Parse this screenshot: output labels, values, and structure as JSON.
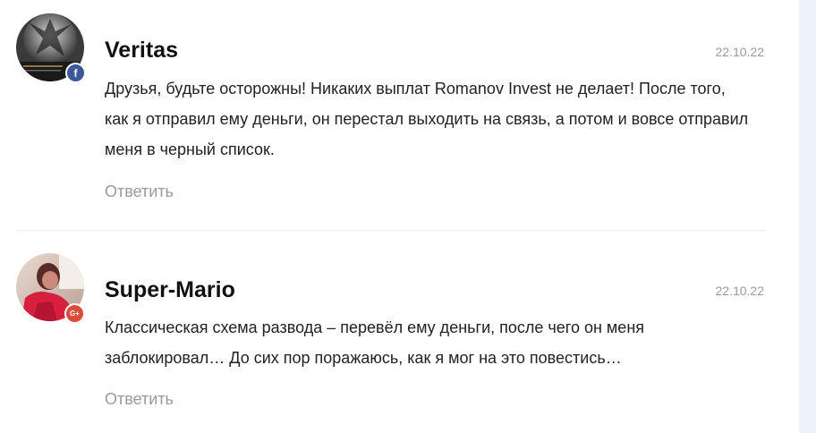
{
  "comments": [
    {
      "author": "Veritas",
      "date": "22.10.22",
      "text": "Друзья, будьте осторожны! Никаких выплат Romanov Invest не делает! После того, как я отправил ему деньги, он перестал выходить на связь, а потом и вовсе отправил меня в черный список.",
      "reply_label": "Ответить",
      "social": "facebook",
      "social_glyph": "f",
      "social_color": "#3b5998"
    },
    {
      "author": "Super-Mario",
      "date": "22.10.22",
      "text": "Классическая схема развода – перевёл ему деньги, после чего он меня заблокировал… До сих пор поражаюсь, как я мог на это повестись…",
      "reply_label": "Ответить",
      "social": "google-plus",
      "social_glyph": "G+",
      "social_color": "#dd4b39"
    }
  ],
  "colors": {
    "author": "#111111",
    "text": "#222222",
    "muted": "#9a9a9a",
    "divider": "#eeeeee",
    "sidebar_bg": "#eef2f9"
  }
}
